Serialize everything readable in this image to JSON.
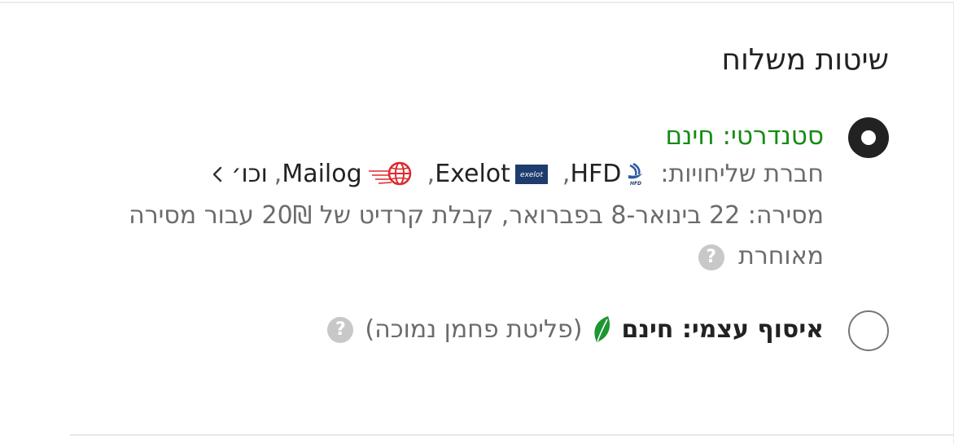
{
  "shipping": {
    "title": "שיטות משלוח",
    "standard": {
      "label": "סטנדרטי: חינם",
      "selected": true,
      "carriers_prefix": "חברת שליחויות:",
      "carriers": [
        {
          "name": "HFD",
          "logo": "hfd-logo-icon"
        },
        {
          "name": "Exelot",
          "logo": "exelot-logo-icon",
          "logo_text": "exelot"
        },
        {
          "name": "Mailog",
          "logo": "mailog-globe-icon"
        }
      ],
      "separator": ",",
      "etc": "וכו׳",
      "delivery_line": "מסירה: 22 בינואר-8 בפברואר, קבלת קרדיט של 20₪ עבור מסירה מאוחרת",
      "help_glyph": "?"
    },
    "pickup": {
      "label": "איסוף עצמי: חינם",
      "selected": false,
      "note": "(פליטת פחמן נמוכה)",
      "leaf_icon": "leaf-icon",
      "help_glyph": "?"
    }
  },
  "colors": {
    "green": "#148c14",
    "text": "#222222",
    "muted": "#6b6b6b",
    "help_bg": "#c8c8c8",
    "hfd_blue": "#2d5aa0",
    "exelot_navy": "#1e3c6e",
    "mailog_red": "#e0282d"
  }
}
